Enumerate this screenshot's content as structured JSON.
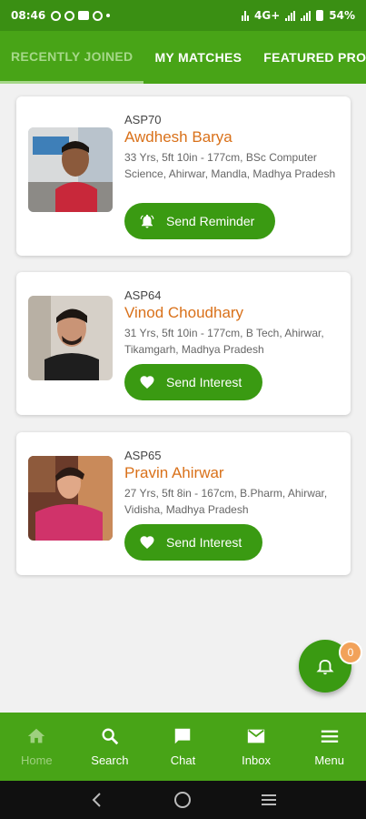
{
  "status_bar": {
    "time": "08:46",
    "network": "4G+",
    "battery": "54%"
  },
  "tabs": [
    {
      "label": "RECENTLY JOINED",
      "active": true
    },
    {
      "label": "MY MATCHES",
      "active": false
    },
    {
      "label": "FEATURED PROFILES",
      "active": false
    }
  ],
  "profiles": [
    {
      "id": "ASP70",
      "name": "Awdhesh  Barya",
      "desc": "33 Yrs, 5ft 10in - 177cm, BSc Computer Science, Ahirwar, Mandla, Madhya Pradesh",
      "action": "Send Reminder",
      "action_icon": "bell-icon"
    },
    {
      "id": "ASP64",
      "name": "Vinod  Choudhary",
      "desc": "31 Yrs, 5ft 10in - 177cm, B Tech, Ahirwar, Tikamgarh, Madhya Pradesh",
      "action": "Send Interest",
      "action_icon": "heart-icon"
    },
    {
      "id": "ASP65",
      "name": "Pravin Ahirwar",
      "desc": "27 Yrs, 5ft 8in - 167cm, B.Pharm, Ahirwar, Vidisha, Madhya Pradesh",
      "action": "Send Interest",
      "action_icon": "heart-icon"
    }
  ],
  "fab": {
    "badge": "0",
    "icon": "bell-icon"
  },
  "bottom_nav": [
    {
      "label": "Home",
      "icon": "home-icon",
      "active": true
    },
    {
      "label": "Search",
      "icon": "search-icon",
      "active": false
    },
    {
      "label": "Chat",
      "icon": "chat-icon",
      "active": false
    },
    {
      "label": "Inbox",
      "icon": "mail-icon",
      "active": false
    },
    {
      "label": "Menu",
      "icon": "menu-icon",
      "active": false
    }
  ],
  "colors": {
    "primary": "#48a417",
    "button": "#3a9a12",
    "name": "#d9711a",
    "active_tab": "#a6d889",
    "badge": "#f2a25a"
  }
}
